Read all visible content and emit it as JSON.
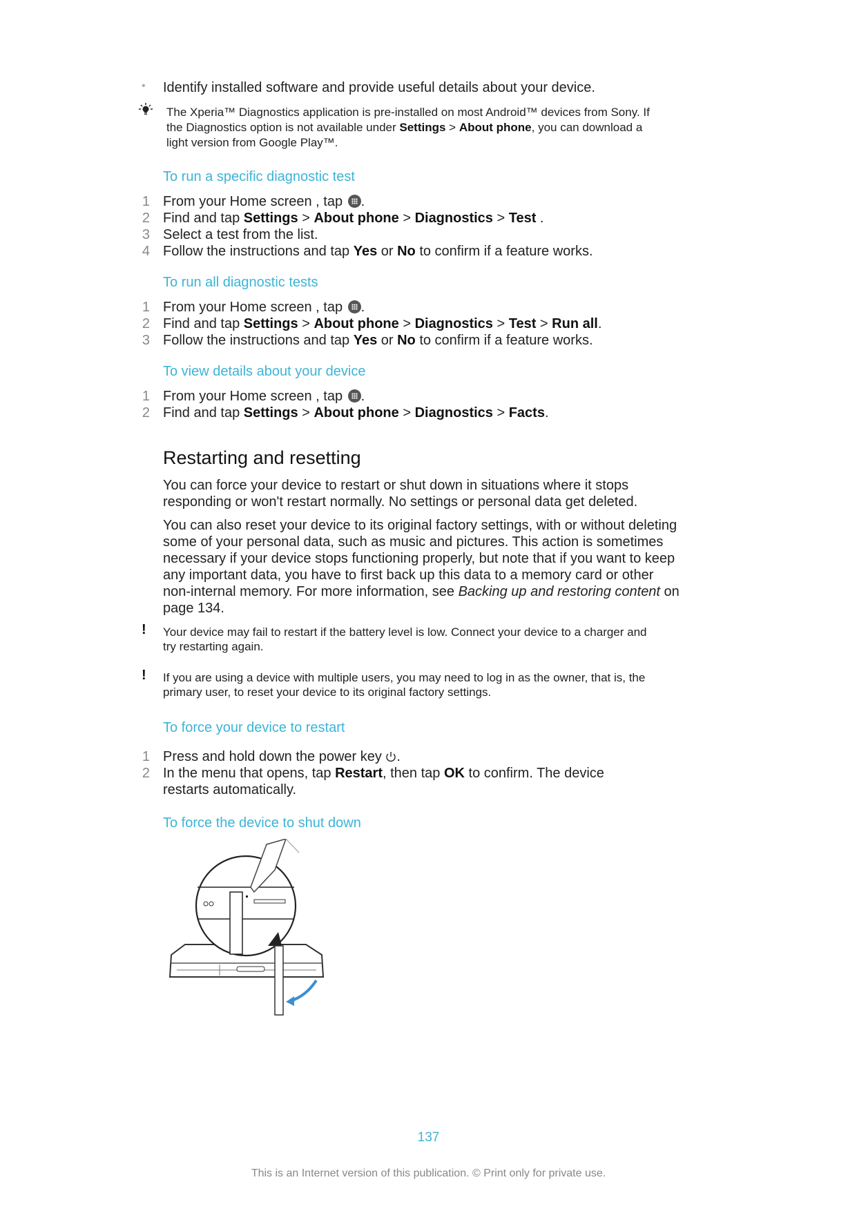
{
  "bullets": [
    "Identify installed software and provide useful details about your device."
  ],
  "tip": {
    "icon": "lightbulb-icon",
    "line1": "The Xperia™ Diagnostics application is pre-installed on most Android™ devices from Sony. If",
    "line2_pre": "the Diagnostics option is not available under ",
    "line2_b1": "Settings",
    "line2_sep": " > ",
    "line2_b2": "About phone",
    "line2_post": ", you can download a",
    "line3": "light version from Google Play™."
  },
  "sections": {
    "specific": {
      "title": "To run a specific diagnostic test",
      "steps": [
        {
          "n": "1",
          "pre": "From your Home screen , tap ",
          "post": "."
        },
        {
          "n": "2",
          "pre": "Find and tap ",
          "path": [
            "Settings",
            "About phone",
            "Diagnostics",
            "Test"
          ],
          "post": " ."
        },
        {
          "n": "3",
          "text": "Select a test from the list."
        },
        {
          "n": "4",
          "pre": "Follow the instructions and tap ",
          "b1": "Yes",
          "mid": " or ",
          "b2": "No",
          "post": " to confirm if a feature works."
        }
      ]
    },
    "all": {
      "title": "To run all diagnostic tests",
      "steps": [
        {
          "n": "1",
          "pre": "From your Home screen , tap ",
          "post": "."
        },
        {
          "n": "2",
          "pre": "Find and tap ",
          "path": [
            "Settings",
            "About phone",
            "Diagnostics",
            "Test",
            "Run all"
          ],
          "post": "."
        },
        {
          "n": "3",
          "pre": "Follow the instructions and tap ",
          "b1": "Yes",
          "mid": " or ",
          "b2": "No",
          "post": " to confirm if a feature works."
        }
      ]
    },
    "details": {
      "title": "To view details about your device",
      "steps": [
        {
          "n": "1",
          "pre": "From your Home screen , tap ",
          "post": "."
        },
        {
          "n": "2",
          "pre": "Find and tap ",
          "path": [
            "Settings",
            "About phone",
            "Diagnostics",
            "Facts"
          ],
          "post": "."
        }
      ]
    },
    "restart": {
      "title": "To force your device to restart",
      "steps": [
        {
          "n": "1",
          "pre": "Press and hold down the power key ",
          "post": "."
        },
        {
          "n": "2",
          "pre": "In the menu that opens, tap ",
          "b1": "Restart",
          "mid": ", then tap ",
          "b2": "OK",
          "post": " to confirm. The device",
          "line2": "restarts automatically."
        }
      ]
    },
    "shutdown": {
      "title": "To force the device to shut down"
    }
  },
  "restarting": {
    "heading": "Restarting and resetting",
    "p1": [
      "You can force your device to restart or shut down in situations where it stops",
      "responding or won't restart normally. No settings or personal data get deleted."
    ],
    "p2": [
      "You can also reset your device to its original factory settings, with or without deleting",
      "some of your personal data, such as music and pictures. This action is sometimes",
      "necessary if your device stops functioning properly, but note that if you want to keep",
      "any important data, you have to first back up this data to a memory card or other"
    ],
    "p2_last_pre": "non-internal memory. For more information, see ",
    "p2_link": "Backing up and restoring content",
    "p2_last_post": " on",
    "p2_end": "page 134.",
    "warn1": [
      "Your device may fail to restart if the battery level is low. Connect your device to a charger and",
      "try restarting again."
    ],
    "warn2": [
      "If you are using a device with multiple users, you may need to log in as the owner, that is, the",
      "primary user, to reset your device to its original factory settings."
    ]
  },
  "sep": " > ",
  "footer": {
    "page_number": "137",
    "notice": "This is an Internet version of this publication. © Print only for private use."
  },
  "colors": {
    "accent": "#3cb4d6",
    "text": "#222222",
    "muted": "#888888"
  }
}
